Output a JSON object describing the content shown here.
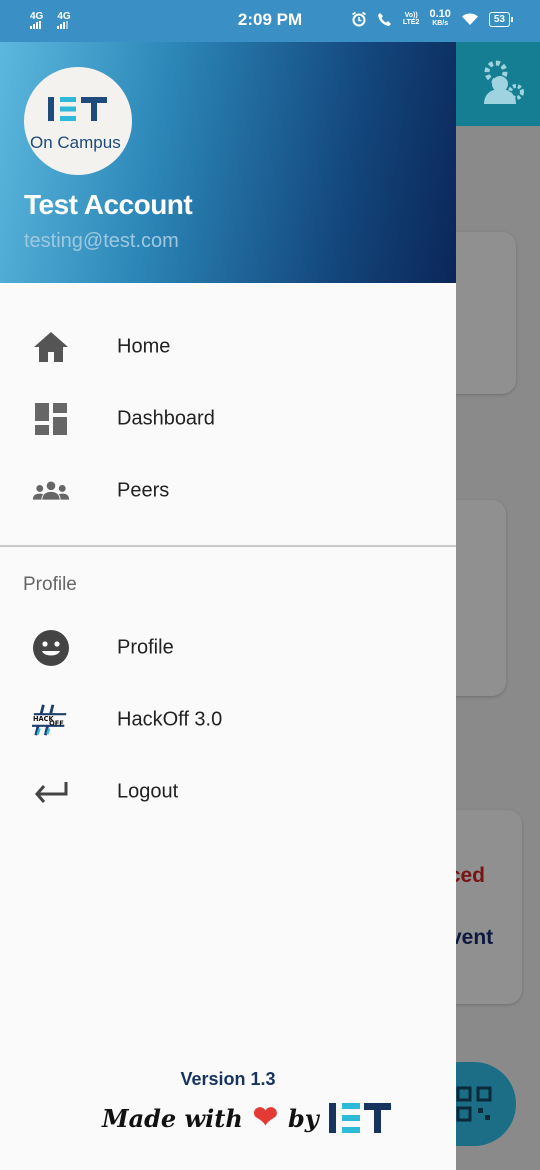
{
  "status_bar": {
    "net1": "4G",
    "net2": "4G",
    "time": "2:09 PM",
    "volte": "Vo))",
    "lte": "LTE2",
    "speed": "0.10",
    "speed_unit": "KB/s",
    "battery": "53"
  },
  "drawer": {
    "header": {
      "logo_letters": "IET",
      "logo_subtitle": "On Campus",
      "account_name": "Test Account",
      "account_email": "testing@test.com"
    },
    "items": [
      {
        "label": "Home",
        "icon": "home-icon"
      },
      {
        "label": "Dashboard",
        "icon": "dashboard-icon"
      },
      {
        "label": "Peers",
        "icon": "people-icon"
      }
    ],
    "profile_section": {
      "title": "Profile",
      "items": [
        {
          "label": "Profile",
          "icon": "smiley-icon"
        },
        {
          "label": "HackOff 3.0",
          "icon": "hackoff-logo-icon"
        },
        {
          "label": "Logout",
          "icon": "return-arrow-icon"
        }
      ]
    },
    "footer": {
      "version": "Version 1.3",
      "made_with": "Made with",
      "by": "by",
      "brand": "IET"
    }
  },
  "background": {
    "text1": "nced",
    "text2": "vent"
  },
  "colors": {
    "status_bar": "#3a8fc4",
    "header_start": "#5cb8dd",
    "header_end": "#0b2658",
    "heart": "#e53935",
    "accent_text": "#c62828"
  }
}
